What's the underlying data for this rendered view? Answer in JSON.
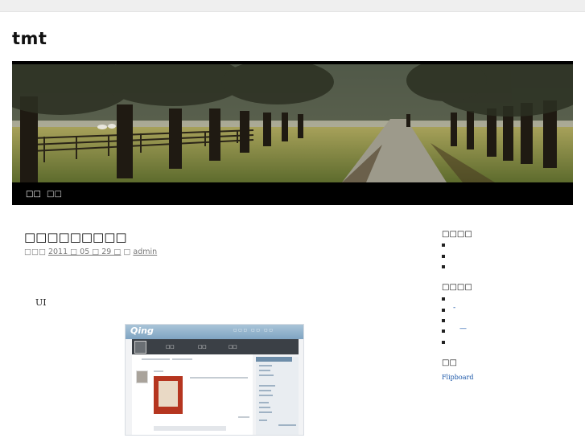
{
  "site": {
    "title": "tmt"
  },
  "nav": {
    "items": [
      "□□",
      "□□"
    ]
  },
  "post": {
    "title": "□□□□□□□□□",
    "meta_prefix": "□□□",
    "date_link": "2011 □ 05 □ 29 □",
    "meta_sep": "□",
    "author_link": "admin",
    "body_text": "UI"
  },
  "screenshot": {
    "logo": "Qing",
    "top_links": "□□□ □□ □□",
    "tabs": [
      "□□",
      "□□",
      "□□"
    ]
  },
  "sidebar": {
    "section1": {
      "heading": "□□□□",
      "item_count": 3
    },
    "section2": {
      "heading": "□□□□",
      "item_count": 5,
      "marks": [
        "-",
        "—"
      ]
    },
    "section3": {
      "heading": "□□",
      "link": "Flipboard"
    }
  }
}
